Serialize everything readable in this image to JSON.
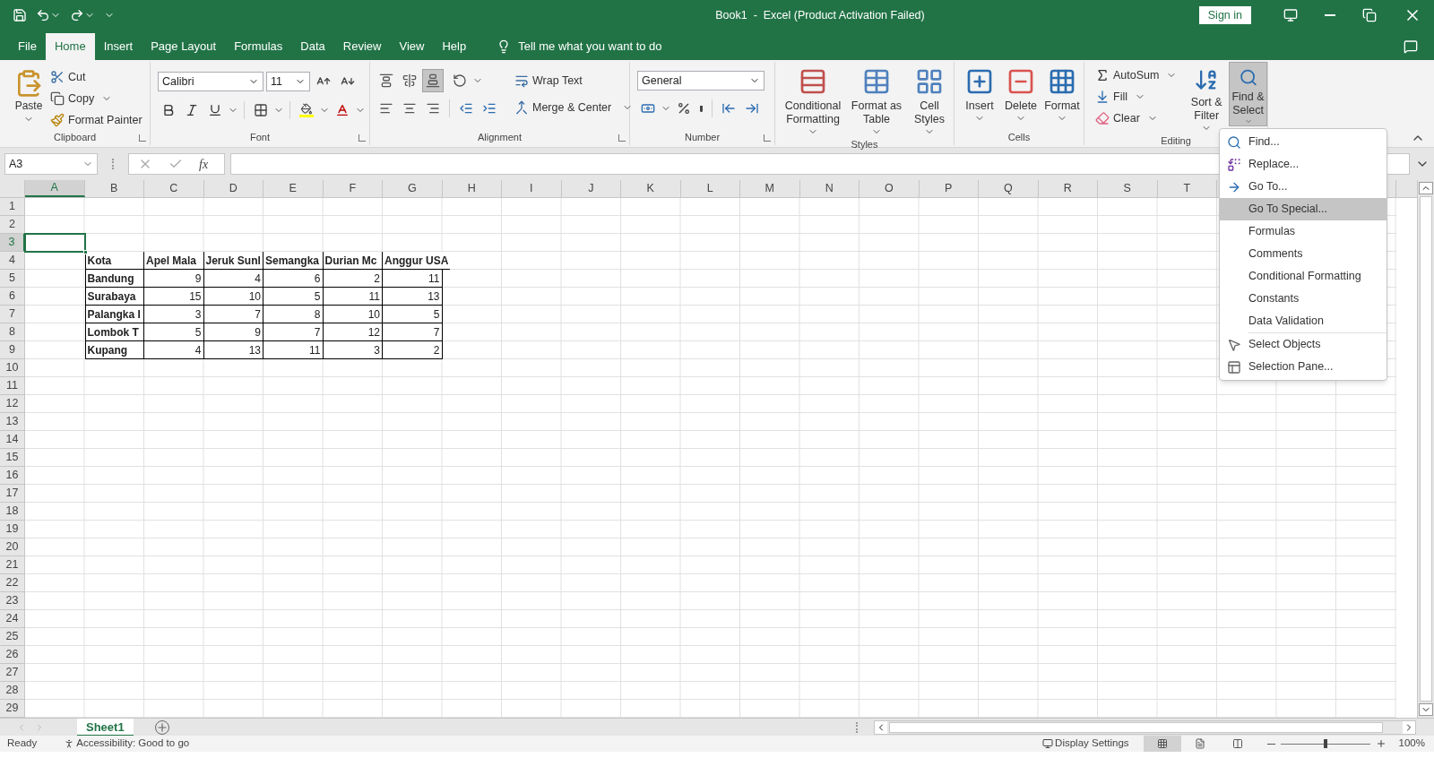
{
  "title_bar": {
    "title": "Book1  -  Excel (Product Activation Failed)",
    "sign_in": "Sign in"
  },
  "tabs": [
    {
      "label": "File",
      "selected": false
    },
    {
      "label": "Home",
      "selected": true
    },
    {
      "label": "Insert",
      "selected": false
    },
    {
      "label": "Page Layout",
      "selected": false
    },
    {
      "label": "Formulas",
      "selected": false
    },
    {
      "label": "Data",
      "selected": false
    },
    {
      "label": "Review",
      "selected": false
    },
    {
      "label": "View",
      "selected": false
    },
    {
      "label": "Help",
      "selected": false
    }
  ],
  "tell_me": "Tell me what you want to do",
  "ribbon": {
    "groups": [
      {
        "kind": "clipboard",
        "label": "Clipboard",
        "paste": "Paste",
        "items": [
          "Cut",
          "Copy",
          "Format Painter"
        ]
      },
      {
        "kind": "font",
        "label": "Font",
        "font_name": "Calibri",
        "font_size": "11"
      },
      {
        "kind": "alignment",
        "label": "Alignment",
        "vertical_align": [
          {
            "selected": false
          },
          {
            "selected": false
          },
          {
            "selected": true
          }
        ],
        "wrap": "Wrap Text",
        "merge": "Merge & Center"
      },
      {
        "kind": "number",
        "label": "Number",
        "format": "General"
      },
      {
        "kind": "styles",
        "label": "Styles",
        "buttons": [
          "Conditional Formatting",
          "Format as Table",
          "Cell Styles"
        ]
      },
      {
        "kind": "cells",
        "label": "Cells",
        "buttons": [
          "Insert",
          "Delete",
          "Format"
        ]
      },
      {
        "kind": "editing",
        "label": "Editing",
        "items": [
          "AutoSum",
          "Fill",
          "Clear"
        ],
        "sort": "Sort & Filter",
        "find": {
          "label": "Find & Select",
          "pressed": true
        }
      }
    ]
  },
  "formula_bar": {
    "name_box": "A3",
    "fx": "fx"
  },
  "sheet": {
    "columns": [
      {
        "label": "A",
        "selected": true
      },
      {
        "label": "B",
        "selected": false
      },
      {
        "label": "C",
        "selected": false
      },
      {
        "label": "D",
        "selected": false
      },
      {
        "label": "E",
        "selected": false
      },
      {
        "label": "F",
        "selected": false
      },
      {
        "label": "G",
        "selected": false
      },
      {
        "label": "H",
        "selected": false
      },
      {
        "label": "I",
        "selected": false
      },
      {
        "label": "J",
        "selected": false
      },
      {
        "label": "K",
        "selected": false
      },
      {
        "label": "L",
        "selected": false
      },
      {
        "label": "M",
        "selected": false
      },
      {
        "label": "N",
        "selected": false
      },
      {
        "label": "O",
        "selected": false
      },
      {
        "label": "P",
        "selected": false
      },
      {
        "label": "Q",
        "selected": false
      },
      {
        "label": "R",
        "selected": false
      },
      {
        "label": "S",
        "selected": false
      },
      {
        "label": "T",
        "selected": false
      }
    ],
    "rows": [
      {
        "label": "1",
        "selected": false
      },
      {
        "label": "2",
        "selected": false
      },
      {
        "label": "3",
        "selected": true
      },
      {
        "label": "4",
        "selected": false
      },
      {
        "label": "5",
        "selected": false
      },
      {
        "label": "6",
        "selected": false
      },
      {
        "label": "7",
        "selected": false
      },
      {
        "label": "8",
        "selected": false
      },
      {
        "label": "9",
        "selected": false
      },
      {
        "label": "10",
        "selected": false
      },
      {
        "label": "11",
        "selected": false
      },
      {
        "label": "12",
        "selected": false
      },
      {
        "label": "13",
        "selected": false
      },
      {
        "label": "14",
        "selected": false
      },
      {
        "label": "15",
        "selected": false
      },
      {
        "label": "16",
        "selected": false
      },
      {
        "label": "17",
        "selected": false
      },
      {
        "label": "18",
        "selected": false
      },
      {
        "label": "19",
        "selected": false
      },
      {
        "label": "20",
        "selected": false
      },
      {
        "label": "21",
        "selected": false
      },
      {
        "label": "22",
        "selected": false
      },
      {
        "label": "23",
        "selected": false
      },
      {
        "label": "24",
        "selected": false
      },
      {
        "label": "25",
        "selected": false
      },
      {
        "label": "26",
        "selected": false
      },
      {
        "label": "27",
        "selected": false
      },
      {
        "label": "28",
        "selected": false
      },
      {
        "label": "29",
        "selected": false
      }
    ],
    "table": {
      "header": [
        "Kota",
        "Apel Mala",
        "Jeruk Sunl",
        "Semangka",
        "Durian Mc",
        "Anggur USA"
      ],
      "rows": [
        [
          "Bandung",
          "9",
          "4",
          "6",
          "2",
          "11"
        ],
        [
          "Surabaya",
          "15",
          "10",
          "5",
          "11",
          "13"
        ],
        [
          "Palangka I",
          "3",
          "7",
          "8",
          "10",
          "5"
        ],
        [
          "Lombok T",
          "5",
          "9",
          "7",
          "12",
          "7"
        ],
        [
          "Kupang",
          "4",
          "13",
          "11",
          "3",
          "2"
        ]
      ]
    }
  },
  "menu": {
    "sections": [
      [
        {
          "label": "Find...",
          "kind": "search",
          "selected": false
        },
        {
          "label": "Replace...",
          "kind": "replace",
          "selected": false
        },
        {
          "label": "Go To...",
          "kind": "arrow",
          "selected": false
        },
        {
          "label": "Go To Special...",
          "kind": "text",
          "selected": true
        },
        {
          "label": "Formulas",
          "kind": "text",
          "selected": false
        },
        {
          "label": "Comments",
          "kind": "text",
          "selected": false
        },
        {
          "label": "Conditional Formatting",
          "kind": "text",
          "selected": false
        },
        {
          "label": "Constants",
          "kind": "text",
          "selected": false
        },
        {
          "label": "Data Validation",
          "kind": "text",
          "selected": false
        }
      ],
      [
        {
          "label": "Select Objects",
          "kind": "pointer",
          "selected": false
        },
        {
          "label": "Selection Pane...",
          "kind": "pane",
          "selected": false
        }
      ]
    ]
  },
  "sheet_tabs": [
    {
      "label": "Sheet1",
      "selected": true
    }
  ],
  "status_bar": {
    "ready": "Ready",
    "accessibility": "Accessibility: Good to go",
    "display_settings": "Display Settings",
    "views": [
      {
        "selected": true
      },
      {
        "selected": false
      },
      {
        "selected": false
      }
    ],
    "zoom": {
      "level": 0.5,
      "reading": "100%"
    }
  }
}
